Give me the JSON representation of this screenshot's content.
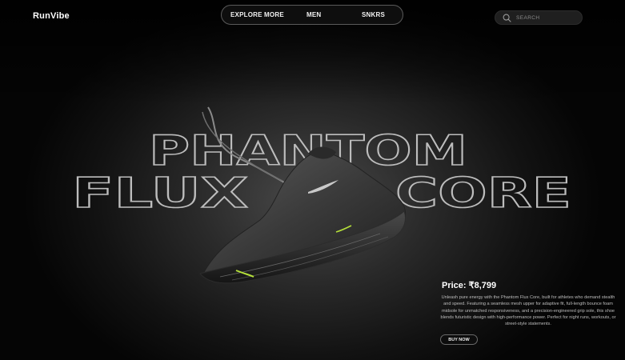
{
  "brand": {
    "name": "RunVibe"
  },
  "nav": {
    "items": [
      {
        "label": "EXPLORE MORE"
      },
      {
        "label": "MEN"
      },
      {
        "label": "SNKRS"
      }
    ]
  },
  "search": {
    "placeholder": "SEARCH",
    "icon": "search-icon"
  },
  "hero": {
    "line1": "PHANTOM",
    "line2a": "FLUX",
    "line2b": "CORE",
    "product_image": "sneaker-image"
  },
  "product": {
    "price_label": "Price: ₹8,799",
    "description": "Unleash pure energy with the Phantom Flux Core, built for athletes who demand stealth and speed. Featuring a seamless mesh upper for adaptive fit, full-length bounce foam midsole for unmatched responsiveness, and a precision-engineered grip sole, this shoe blends futuristic design with high-performance power. Perfect for night runs, workouts, or street-style statements.",
    "buy_label": "BUY NOW"
  },
  "colors": {
    "background": "#000000",
    "text": "#ffffff",
    "accent": "#b5e03a"
  }
}
